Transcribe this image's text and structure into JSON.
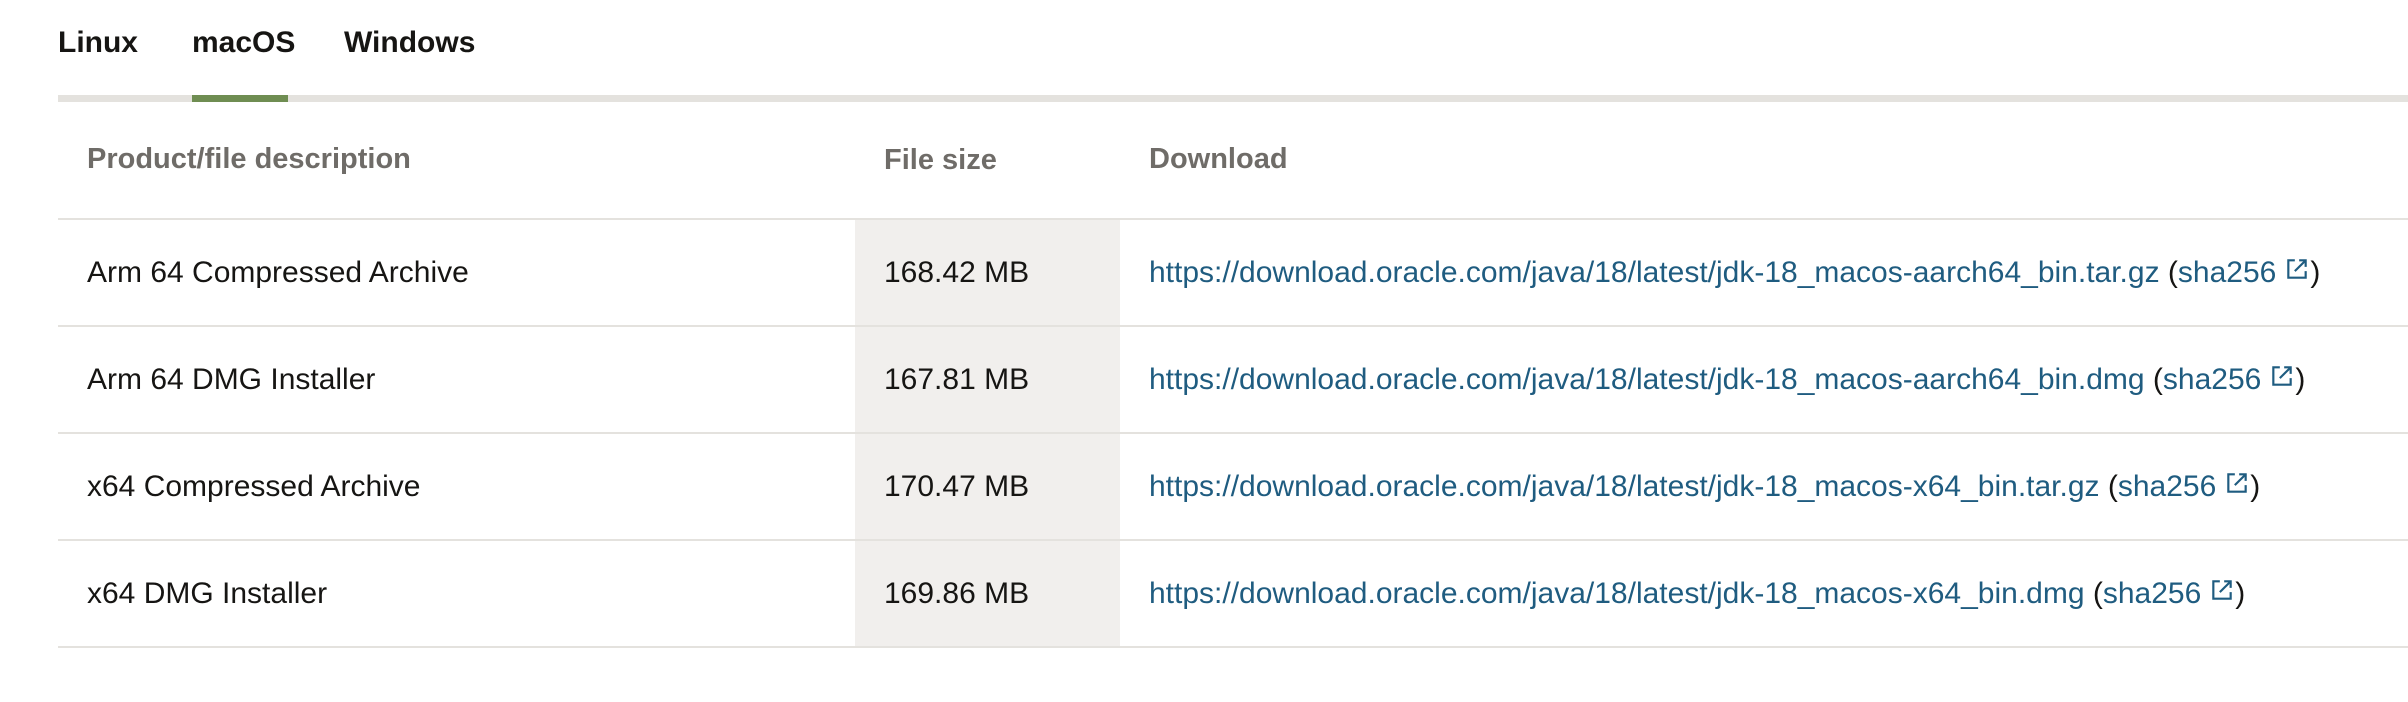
{
  "tabs": [
    {
      "label": "Linux",
      "selected": false
    },
    {
      "label": "macOS",
      "selected": true
    },
    {
      "label": "Windows",
      "selected": false
    }
  ],
  "table": {
    "headers": {
      "description": "Product/file description",
      "size": "File size",
      "download": "Download"
    },
    "rows": [
      {
        "description": "Arm 64 Compressed Archive",
        "size": "168.42 MB",
        "link": "https://download.oracle.com/java/18/latest/jdk-18_macos-aarch64_bin.tar.gz",
        "checksum": "sha256"
      },
      {
        "description": "Arm 64 DMG Installer",
        "size": "167.81 MB",
        "link": "https://download.oracle.com/java/18/latest/jdk-18_macos-aarch64_bin.dmg",
        "checksum": "sha256"
      },
      {
        "description": "x64 Compressed Archive",
        "size": "170.47 MB",
        "link": "https://download.oracle.com/java/18/latest/jdk-18_macos-x64_bin.tar.gz",
        "checksum": "sha256"
      },
      {
        "description": "x64 DMG Installer",
        "size": "169.86 MB",
        "link": "https://download.oracle.com/java/18/latest/jdk-18_macos-x64_bin.dmg",
        "checksum": "sha256"
      }
    ]
  },
  "icons": {
    "external_link": "external-link-icon"
  },
  "colors": {
    "accent_underline": "#6f8d52",
    "link": "#1f5c80",
    "size_column_bg": "#f1efed"
  }
}
